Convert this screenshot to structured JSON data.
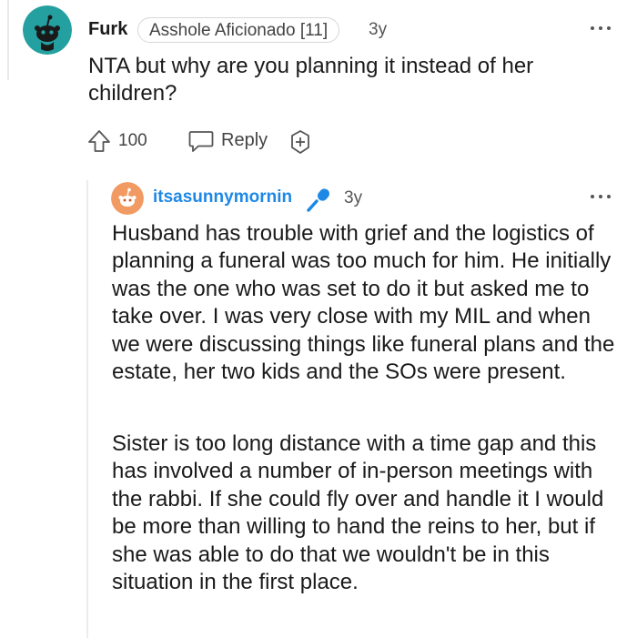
{
  "parent_comment": {
    "username": "Furk",
    "flair": "Asshole Aficionado [11]",
    "age": "3y",
    "body": "NTA but why are you planning it instead of her children?",
    "avatar_color": "#24a0a0",
    "avatar_icon": "snoo-avatar-icon",
    "more_icon": "more-options-icon",
    "actions": {
      "vote_icon": "upvote-arrow-icon",
      "vote_count": "100",
      "reply_icon": "reply-bubble-icon",
      "reply_label": "Reply",
      "award_icon": "award-add-icon"
    }
  },
  "reply_comment": {
    "username": "itsasunnymornin",
    "username_color": "#1e88e5",
    "op_badge_icon": "microphone-icon",
    "age": "3y",
    "avatar_color": "#f29a63",
    "avatar_icon": "snoo-avatar-icon",
    "more_icon": "more-options-icon",
    "paragraphs": [
      "Husband has trouble with grief and the logistics of planning a funeral was too much for him. He initially was the one who was set to do it but asked me to take over. I was very close with my MIL and when we were discussing things like funeral plans and the estate, her two kids and the SOs were present.",
      "Sister is too long distance with a time gap and this has involved a number of in-person meetings with the rabbi. If she could fly over and handle it I would be more than willing to hand the reins to her, but if she was able to do that we wouldn't be in this situation in the first place."
    ]
  }
}
